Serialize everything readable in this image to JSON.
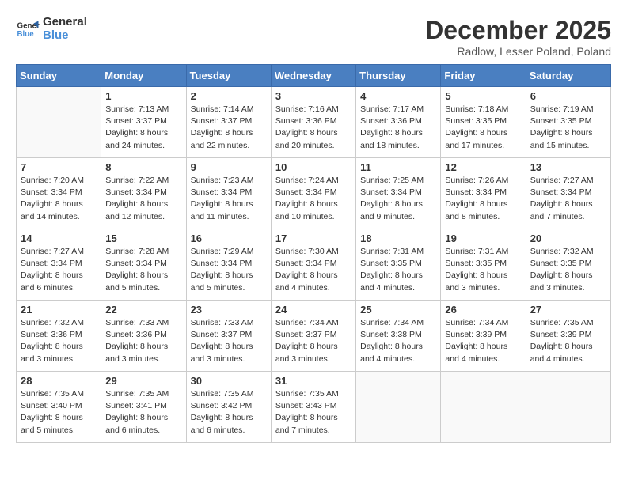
{
  "logo": {
    "line1": "General",
    "line2": "Blue"
  },
  "title": "December 2025",
  "location": "Radlow, Lesser Poland, Poland",
  "days_header": [
    "Sunday",
    "Monday",
    "Tuesday",
    "Wednesday",
    "Thursday",
    "Friday",
    "Saturday"
  ],
  "weeks": [
    [
      {
        "day": "",
        "sunrise": "",
        "sunset": "",
        "daylight": ""
      },
      {
        "day": "1",
        "sunrise": "Sunrise: 7:13 AM",
        "sunset": "Sunset: 3:37 PM",
        "daylight": "Daylight: 8 hours and 24 minutes."
      },
      {
        "day": "2",
        "sunrise": "Sunrise: 7:14 AM",
        "sunset": "Sunset: 3:37 PM",
        "daylight": "Daylight: 8 hours and 22 minutes."
      },
      {
        "day": "3",
        "sunrise": "Sunrise: 7:16 AM",
        "sunset": "Sunset: 3:36 PM",
        "daylight": "Daylight: 8 hours and 20 minutes."
      },
      {
        "day": "4",
        "sunrise": "Sunrise: 7:17 AM",
        "sunset": "Sunset: 3:36 PM",
        "daylight": "Daylight: 8 hours and 18 minutes."
      },
      {
        "day": "5",
        "sunrise": "Sunrise: 7:18 AM",
        "sunset": "Sunset: 3:35 PM",
        "daylight": "Daylight: 8 hours and 17 minutes."
      },
      {
        "day": "6",
        "sunrise": "Sunrise: 7:19 AM",
        "sunset": "Sunset: 3:35 PM",
        "daylight": "Daylight: 8 hours and 15 minutes."
      }
    ],
    [
      {
        "day": "7",
        "sunrise": "Sunrise: 7:20 AM",
        "sunset": "Sunset: 3:34 PM",
        "daylight": "Daylight: 8 hours and 14 minutes."
      },
      {
        "day": "8",
        "sunrise": "Sunrise: 7:22 AM",
        "sunset": "Sunset: 3:34 PM",
        "daylight": "Daylight: 8 hours and 12 minutes."
      },
      {
        "day": "9",
        "sunrise": "Sunrise: 7:23 AM",
        "sunset": "Sunset: 3:34 PM",
        "daylight": "Daylight: 8 hours and 11 minutes."
      },
      {
        "day": "10",
        "sunrise": "Sunrise: 7:24 AM",
        "sunset": "Sunset: 3:34 PM",
        "daylight": "Daylight: 8 hours and 10 minutes."
      },
      {
        "day": "11",
        "sunrise": "Sunrise: 7:25 AM",
        "sunset": "Sunset: 3:34 PM",
        "daylight": "Daylight: 8 hours and 9 minutes."
      },
      {
        "day": "12",
        "sunrise": "Sunrise: 7:26 AM",
        "sunset": "Sunset: 3:34 PM",
        "daylight": "Daylight: 8 hours and 8 minutes."
      },
      {
        "day": "13",
        "sunrise": "Sunrise: 7:27 AM",
        "sunset": "Sunset: 3:34 PM",
        "daylight": "Daylight: 8 hours and 7 minutes."
      }
    ],
    [
      {
        "day": "14",
        "sunrise": "Sunrise: 7:27 AM",
        "sunset": "Sunset: 3:34 PM",
        "daylight": "Daylight: 8 hours and 6 minutes."
      },
      {
        "day": "15",
        "sunrise": "Sunrise: 7:28 AM",
        "sunset": "Sunset: 3:34 PM",
        "daylight": "Daylight: 8 hours and 5 minutes."
      },
      {
        "day": "16",
        "sunrise": "Sunrise: 7:29 AM",
        "sunset": "Sunset: 3:34 PM",
        "daylight": "Daylight: 8 hours and 5 minutes."
      },
      {
        "day": "17",
        "sunrise": "Sunrise: 7:30 AM",
        "sunset": "Sunset: 3:34 PM",
        "daylight": "Daylight: 8 hours and 4 minutes."
      },
      {
        "day": "18",
        "sunrise": "Sunrise: 7:31 AM",
        "sunset": "Sunset: 3:35 PM",
        "daylight": "Daylight: 8 hours and 4 minutes."
      },
      {
        "day": "19",
        "sunrise": "Sunrise: 7:31 AM",
        "sunset": "Sunset: 3:35 PM",
        "daylight": "Daylight: 8 hours and 3 minutes."
      },
      {
        "day": "20",
        "sunrise": "Sunrise: 7:32 AM",
        "sunset": "Sunset: 3:35 PM",
        "daylight": "Daylight: 8 hours and 3 minutes."
      }
    ],
    [
      {
        "day": "21",
        "sunrise": "Sunrise: 7:32 AM",
        "sunset": "Sunset: 3:36 PM",
        "daylight": "Daylight: 8 hours and 3 minutes."
      },
      {
        "day": "22",
        "sunrise": "Sunrise: 7:33 AM",
        "sunset": "Sunset: 3:36 PM",
        "daylight": "Daylight: 8 hours and 3 minutes."
      },
      {
        "day": "23",
        "sunrise": "Sunrise: 7:33 AM",
        "sunset": "Sunset: 3:37 PM",
        "daylight": "Daylight: 8 hours and 3 minutes."
      },
      {
        "day": "24",
        "sunrise": "Sunrise: 7:34 AM",
        "sunset": "Sunset: 3:37 PM",
        "daylight": "Daylight: 8 hours and 3 minutes."
      },
      {
        "day": "25",
        "sunrise": "Sunrise: 7:34 AM",
        "sunset": "Sunset: 3:38 PM",
        "daylight": "Daylight: 8 hours and 4 minutes."
      },
      {
        "day": "26",
        "sunrise": "Sunrise: 7:34 AM",
        "sunset": "Sunset: 3:39 PM",
        "daylight": "Daylight: 8 hours and 4 minutes."
      },
      {
        "day": "27",
        "sunrise": "Sunrise: 7:35 AM",
        "sunset": "Sunset: 3:39 PM",
        "daylight": "Daylight: 8 hours and 4 minutes."
      }
    ],
    [
      {
        "day": "28",
        "sunrise": "Sunrise: 7:35 AM",
        "sunset": "Sunset: 3:40 PM",
        "daylight": "Daylight: 8 hours and 5 minutes."
      },
      {
        "day": "29",
        "sunrise": "Sunrise: 7:35 AM",
        "sunset": "Sunset: 3:41 PM",
        "daylight": "Daylight: 8 hours and 6 minutes."
      },
      {
        "day": "30",
        "sunrise": "Sunrise: 7:35 AM",
        "sunset": "Sunset: 3:42 PM",
        "daylight": "Daylight: 8 hours and 6 minutes."
      },
      {
        "day": "31",
        "sunrise": "Sunrise: 7:35 AM",
        "sunset": "Sunset: 3:43 PM",
        "daylight": "Daylight: 8 hours and 7 minutes."
      },
      {
        "day": "",
        "sunrise": "",
        "sunset": "",
        "daylight": ""
      },
      {
        "day": "",
        "sunrise": "",
        "sunset": "",
        "daylight": ""
      },
      {
        "day": "",
        "sunrise": "",
        "sunset": "",
        "daylight": ""
      }
    ]
  ]
}
